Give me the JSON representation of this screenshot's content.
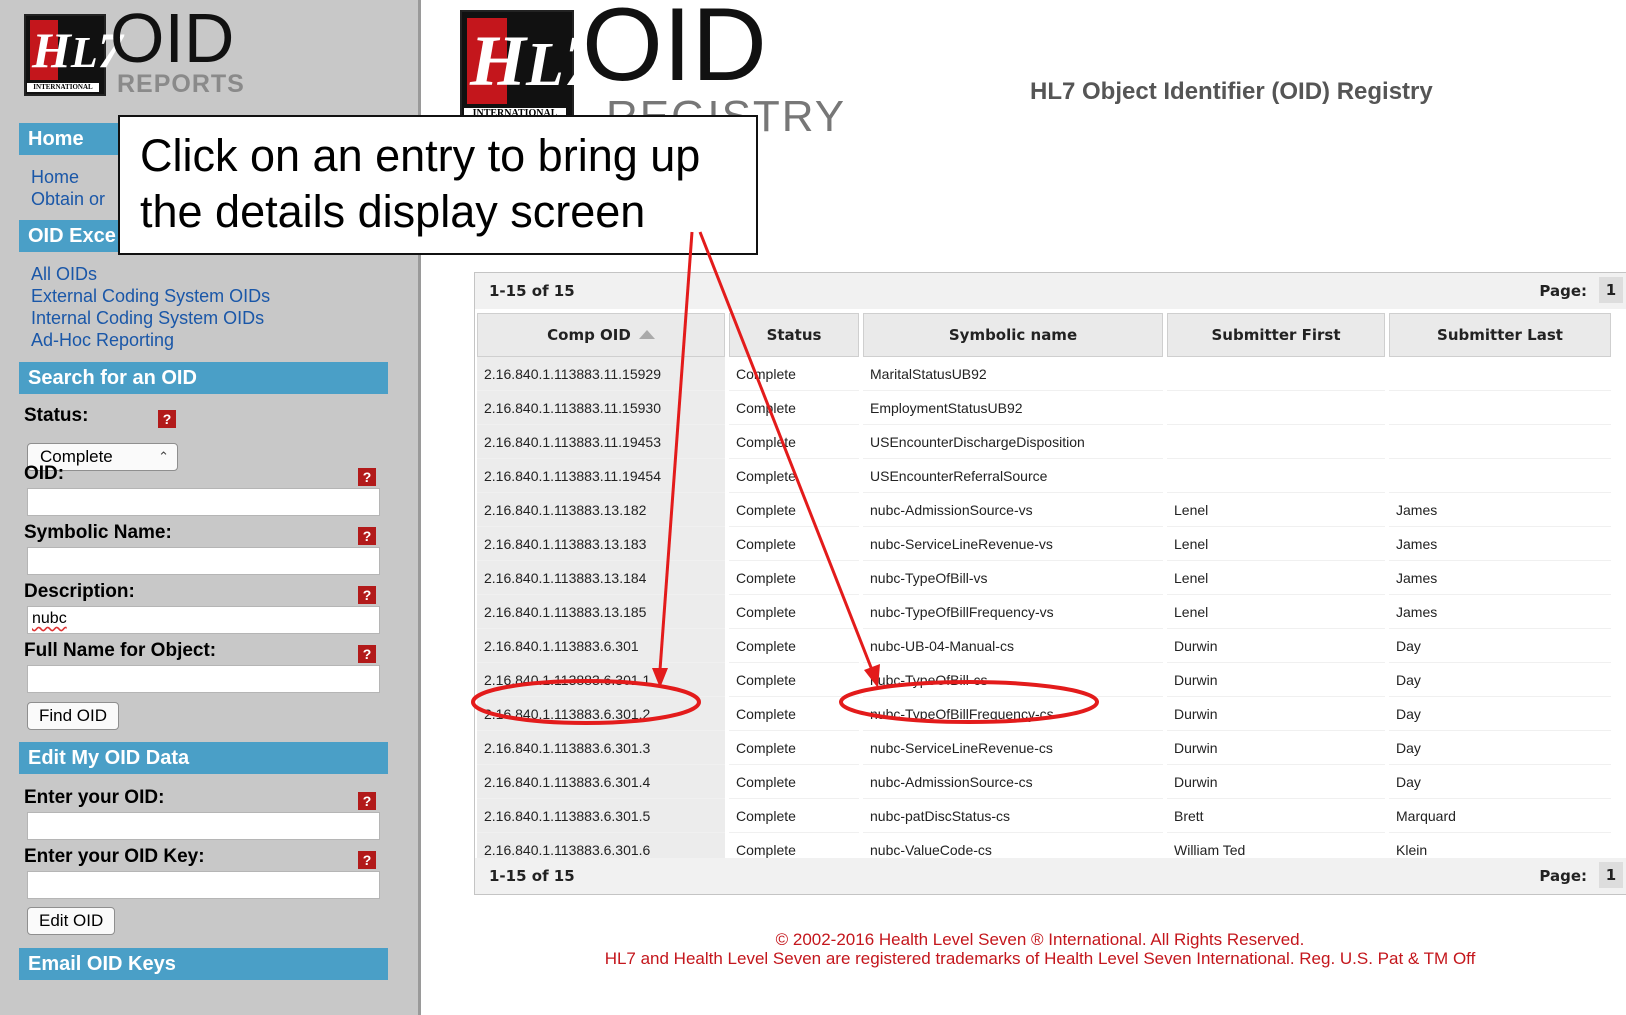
{
  "sidebar": {
    "logo": {
      "intl": "INTERNATIONAL",
      "oid": "OID",
      "sub": "REPORTS"
    },
    "home_section": {
      "title": "Home",
      "links": [
        "Home",
        "Obtain or"
      ]
    },
    "oid_excel": {
      "title": "OID Exce",
      "links": [
        "All OIDs",
        "External Coding System OIDs",
        "Internal Coding System OIDs",
        "Ad-Hoc Reporting"
      ]
    },
    "search": {
      "title": "Search for an OID",
      "status_label": "Status:",
      "status_value": "Complete",
      "oid_label": "OID:",
      "symbolic_label": "Symbolic Name:",
      "description_label": "Description:",
      "description_value": "nubc",
      "fullname_label": "Full Name for Object:",
      "find_button": "Find OID",
      "help_glyph": "?"
    },
    "edit": {
      "title": "Edit My OID Data",
      "oid_label": "Enter your OID:",
      "key_label": "Enter your OID Key:",
      "edit_button": "Edit OID"
    },
    "email": {
      "title": "Email OID Keys"
    }
  },
  "header": {
    "logo": {
      "intl": "INTERNATIONAL",
      "oid": "OID",
      "sub": "REGISTRY"
    },
    "title": "HL7 Object Identifier (OID) Registry"
  },
  "callout": {
    "line1": "Click on an entry to bring up",
    "line2": "the details display screen"
  },
  "table": {
    "count_label": "1-15 of 15",
    "page_label": "Page:",
    "page_number": "1",
    "columns": [
      "Comp OID",
      "Status",
      "Symbolic name",
      "Submitter First",
      "Submitter Last"
    ],
    "rows": [
      {
        "oid": "2.16.840.1.113883.11.15929",
        "status": "Complete",
        "name": "MaritalStatusUB92",
        "first": "",
        "last": ""
      },
      {
        "oid": "2.16.840.1.113883.11.15930",
        "status": "Complete",
        "name": "EmploymentStatusUB92",
        "first": "",
        "last": ""
      },
      {
        "oid": "2.16.840.1.113883.11.19453",
        "status": "Complete",
        "name": "USEncounterDischargeDisposition",
        "first": "",
        "last": ""
      },
      {
        "oid": "2.16.840.1.113883.11.19454",
        "status": "Complete",
        "name": "USEncounterReferralSource",
        "first": "",
        "last": ""
      },
      {
        "oid": "2.16.840.1.113883.13.182",
        "status": "Complete",
        "name": "nubc-AdmissionSource-vs",
        "first": "Lenel",
        "last": "James"
      },
      {
        "oid": "2.16.840.1.113883.13.183",
        "status": "Complete",
        "name": "nubc-ServiceLineRevenue-vs",
        "first": "Lenel",
        "last": "James"
      },
      {
        "oid": "2.16.840.1.113883.13.184",
        "status": "Complete",
        "name": "nubc-TypeOfBill-vs",
        "first": "Lenel",
        "last": "James"
      },
      {
        "oid": "2.16.840.1.113883.13.185",
        "status": "Complete",
        "name": "nubc-TypeOfBillFrequency-vs",
        "first": "Lenel",
        "last": "James"
      },
      {
        "oid": "2.16.840.1.113883.6.301",
        "status": "Complete",
        "name": "nubc-UB-04-Manual-cs",
        "first": "Durwin",
        "last": "Day"
      },
      {
        "oid": "2.16.840.1.113883.6.301.1",
        "status": "Complete",
        "name": "nubc-TypeOfBill-cs",
        "first": "Durwin",
        "last": "Day"
      },
      {
        "oid": "2.16.840.1.113883.6.301.2",
        "status": "Complete",
        "name": "nubc-TypeOfBillFrequency-cs",
        "first": "Durwin",
        "last": "Day"
      },
      {
        "oid": "2.16.840.1.113883.6.301.3",
        "status": "Complete",
        "name": "nubc-ServiceLineRevenue-cs",
        "first": "Durwin",
        "last": "Day"
      },
      {
        "oid": "2.16.840.1.113883.6.301.4",
        "status": "Complete",
        "name": "nubc-AdmissionSource-cs",
        "first": "Durwin",
        "last": "Day"
      },
      {
        "oid": "2.16.840.1.113883.6.301.5",
        "status": "Complete",
        "name": "nubc-patDiscStatus-cs",
        "first": "Brett",
        "last": "Marquard"
      },
      {
        "oid": "2.16.840.1.113883.6.301.6",
        "status": "Complete",
        "name": "nubc-ValueCode-cs",
        "first": "William Ted",
        "last": "Klein"
      }
    ]
  },
  "footer": {
    "line1": "© 2002-2016 Health Level Seven ® International. All Rights Reserved.",
    "line2": "HL7 and Health Level Seven are registered trademarks of Health Level Seven International. Reg. U.S. Pat & TM Off"
  },
  "colors": {
    "accent": "#4a9fc7",
    "link": "#1a57a8",
    "brand_red": "#c4161c",
    "annotation": "#e31b1b"
  }
}
